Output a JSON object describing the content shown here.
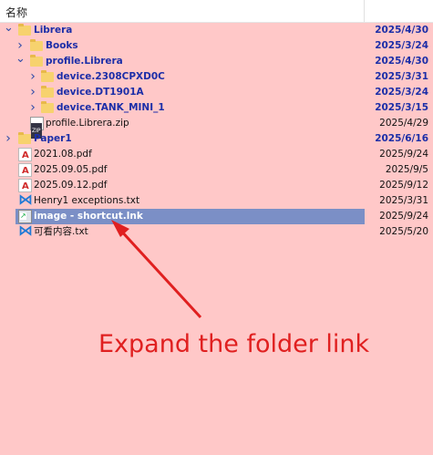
{
  "header": {
    "name_col": "名称"
  },
  "rows": [
    {
      "label": "Librera",
      "date": "2025/4/30",
      "kind": "folder",
      "indent": 0,
      "chev": "v"
    },
    {
      "label": "Books",
      "date": "2025/3/24",
      "kind": "folder",
      "indent": 1,
      "chev": ">"
    },
    {
      "label": "profile.Librera",
      "date": "2025/4/30",
      "kind": "folder",
      "indent": 1,
      "chev": "v"
    },
    {
      "label": "device.2308CPXD0C",
      "date": "2025/3/31",
      "kind": "folder",
      "indent": 2,
      "chev": ">"
    },
    {
      "label": "device.DT1901A",
      "date": "2025/3/24",
      "kind": "folder",
      "indent": 2,
      "chev": ">"
    },
    {
      "label": "device.TANK_MINI_1",
      "date": "2025/3/15",
      "kind": "folder",
      "indent": 2,
      "chev": ">"
    },
    {
      "label": "profile.Librera.zip",
      "date": "2025/4/29",
      "kind": "zip",
      "indent": 1,
      "chev": ""
    },
    {
      "label": "Paper1",
      "date": "2025/6/16",
      "kind": "folder",
      "indent": 0,
      "chev": ">"
    },
    {
      "label": "2021.08.pdf",
      "date": "2025/9/24",
      "kind": "pdf",
      "indent": 0,
      "chev": ""
    },
    {
      "label": "2025.09.05.pdf",
      "date": "2025/9/5",
      "kind": "pdf",
      "indent": 0,
      "chev": ""
    },
    {
      "label": "2025.09.12.pdf",
      "date": "2025/9/12",
      "kind": "pdf",
      "indent": 0,
      "chev": ""
    },
    {
      "label": "Henry1 exceptions.txt",
      "date": "2025/3/31",
      "kind": "vs",
      "indent": 0,
      "chev": ""
    },
    {
      "label": "image - shortcut.lnk",
      "date": "2025/9/24",
      "kind": "lnk",
      "indent": 0,
      "chev": "",
      "selected": true
    },
    {
      "label": "可看内容.txt",
      "date": "2025/5/20",
      "kind": "vs",
      "indent": 0,
      "chev": ""
    }
  ],
  "annotation": {
    "text": "Expand the folder link",
    "color": "#e02020"
  },
  "colors": {
    "background": "#ffc8c8",
    "folder_text": "#1c2ea8",
    "selection": "#7b8fc6"
  }
}
